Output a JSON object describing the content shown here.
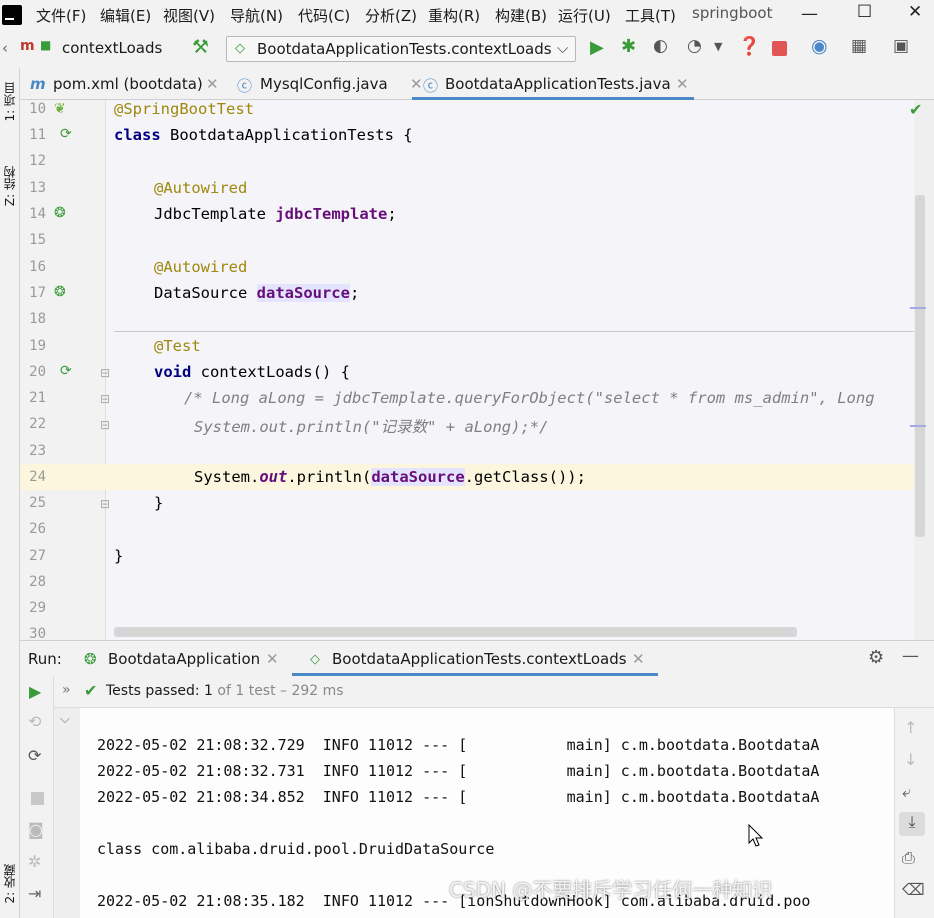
{
  "menubar": {
    "items": [
      "文件(F)",
      "编辑(E)",
      "视图(V)",
      "导航(N)",
      "代码(C)",
      "分析(Z)",
      "重构(R)",
      "构建(B)",
      "运行(U)",
      "工具(T)"
    ],
    "project": "springboot"
  },
  "toolbar": {
    "breadcrumb": "contextLoads",
    "run_config": "BootdataApplicationTests.contextLoads"
  },
  "tabs": [
    {
      "label": "pom.xml (bootdata)",
      "icon": "maven-icon"
    },
    {
      "label": "MysqlConfig.java",
      "icon": "class-icon"
    },
    {
      "label": "BootdataApplicationTests.java",
      "icon": "test-class-icon",
      "active": true
    }
  ],
  "side_labels": {
    "project": "1: 项目",
    "structure": "Z: 结构",
    "favorites": "2: 收藏"
  },
  "editor": {
    "line_numbers": [
      "10",
      "11",
      "12",
      "13",
      "14",
      "15",
      "16",
      "17",
      "18",
      "19",
      "20",
      "21",
      "22",
      "23",
      "24",
      "25",
      "26",
      "27",
      "28",
      "29",
      "30"
    ],
    "lines": {
      "l10": "@SpringBootTest",
      "l11_kw": "class",
      "l11_rest": " BootdataApplicationTests {",
      "l13": "@Autowired",
      "l14_type": "JdbcTemplate ",
      "l14_field": "jdbcTemplate",
      "l14_end": ";",
      "l16": "@Autowired",
      "l17_type": "DataSource ",
      "l17_field": "dataSource",
      "l17_end": ";",
      "l19": "@Test",
      "l20_kw": "void",
      "l20_rest": " contextLoads() {",
      "l21": "/* Long aLong = jdbcTemplate.queryForObject(\"select * from ms_admin\", Long",
      "l22": "System.out.println(\"记录数\" + aLong);*/",
      "l24_a": "System.",
      "l24_out": "out",
      "l24_b": ".println(",
      "l24_ds": "dataSource",
      "l24_c": ".getClass());",
      "l25": "}",
      "l27": "}"
    }
  },
  "run": {
    "label": "Run:",
    "tabs": [
      "BootdataApplication",
      "BootdataApplicationTests.contextLoads"
    ],
    "status_strong": "Tests passed: 1",
    "status_rest": " of 1 test – 292 ms",
    "console": [
      "2022-05-02 21:08:32.729  INFO 11012 --- [           main] c.m.bootdata.BootdataA",
      "2022-05-02 21:08:32.731  INFO 11012 --- [           main] c.m.bootdata.BootdataA",
      "2022-05-02 21:08:34.852  INFO 11012 --- [           main] c.m.bootdata.BootdataA",
      "",
      "class com.alibaba.druid.pool.DruidDataSource",
      "",
      "2022-05-02 21:08:35.182  INFO 11012 --- [ionShutdownHook] com.alibaba.druid.poo"
    ]
  },
  "watermark": "CSDN @不要排斥学习任何一种知识",
  "colors": {
    "accent": "#4a88c7",
    "run_green": "#3a9b3a",
    "stop_red": "#e05555"
  }
}
